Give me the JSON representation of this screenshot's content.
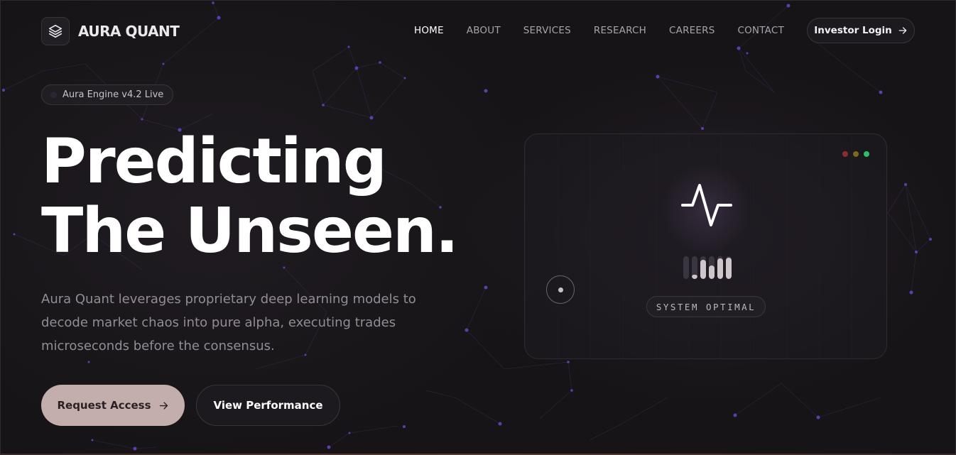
{
  "brand": {
    "name": "AURA QUANT",
    "logo_icon": "layers-icon"
  },
  "nav": {
    "items": [
      {
        "label": "HOME",
        "active": true
      },
      {
        "label": "ABOUT",
        "active": false
      },
      {
        "label": "SERVICES",
        "active": false
      },
      {
        "label": "RESEARCH",
        "active": false
      },
      {
        "label": "CAREERS",
        "active": false
      },
      {
        "label": "CONTACT",
        "active": false
      }
    ],
    "investor_login": "Investor Login"
  },
  "hero": {
    "badge": "Aura Engine v4.2 Live",
    "headline_line1": "Predicting",
    "headline_line2": "The Unseen.",
    "description": "Aura Quant leverages proprietary deep learning models to decode market chaos into pure alpha, executing trades microseconds before the consensus.",
    "primary_cta": "Request Access",
    "secondary_cta": "View Performance"
  },
  "panel": {
    "status": "SYSTEM OPTIMAL",
    "window_dot_colors": [
      "#8a2f2f",
      "#7a6a1e",
      "#2fbf6a"
    ],
    "bar_levels": [
      0.0,
      0.2,
      0.85,
      0.6,
      0.9,
      0.95
    ]
  },
  "colors": {
    "accent": "#c4aeab",
    "background": "#161416",
    "network_node": "#5b3fb0"
  }
}
